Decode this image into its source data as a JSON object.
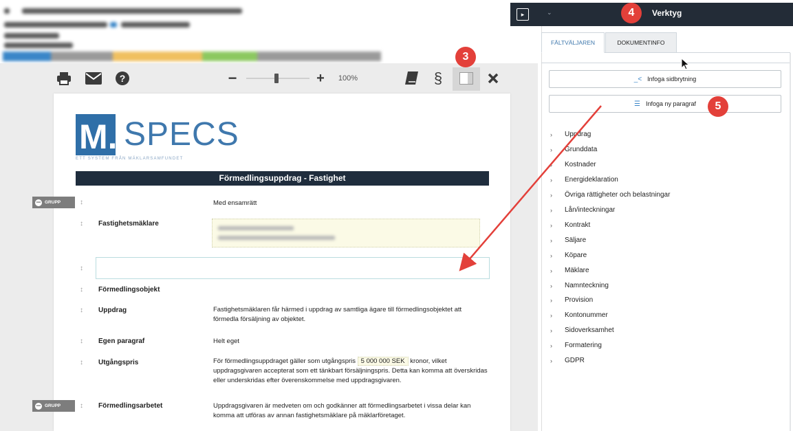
{
  "toolbar": {
    "print_icon": "printer-icon",
    "mail_icon": "envelope-icon",
    "help_icon": "question-icon",
    "zoom_minus": "−",
    "zoom_plus": "+",
    "zoom_value": "100%",
    "book_icon": "book-icon",
    "paragraph_symbol": "§",
    "layout_icon": "panel-toggle-icon",
    "close_icon": "close-icon"
  },
  "logo": {
    "m": "M.",
    "text": "SPECS",
    "tagline": "ETT SYSTEM FRÅN MÄKLARSAMFUNDET"
  },
  "document": {
    "title": "Förmedlingsuppdrag - Fastighet",
    "grupp_label": "GRUPP",
    "rows": [
      {
        "label": "",
        "text": "Med ensamrätt"
      },
      {
        "label": "Fastighetsmäklare",
        "text": ""
      },
      {
        "label": "",
        "text": ""
      },
      {
        "label": "Förmedlingsobjekt",
        "text": ""
      },
      {
        "label": "Uppdrag",
        "text": "Fastighetsmäklaren får härmed i uppdrag av samtliga ägare till förmedlingsobjektet att förmedla försäljning av objektet."
      },
      {
        "label": "Egen paragraf",
        "text": "Helt eget"
      },
      {
        "label": "Utgångspris",
        "text_before": "För förmedlingsuppdraget gäller som utgångspris",
        "highlight": "5 000 000 SEK",
        "text_after": "kronor, vilket uppdragsgivaren accepterat som ett tänkbart försäljningspris. Detta kan komma att överskridas eller underskridas efter överenskommelse med uppdragsgivaren."
      },
      {
        "label": "Förmedlingsarbetet",
        "text": "Uppdragsgivaren är medveten om och godkänner att förmedlingsarbetet i vissa delar kan komma att utföras av annan fastighetsmäklare på mäklarföretaget."
      }
    ]
  },
  "panel": {
    "title": "Verktyg",
    "tabs": [
      {
        "label": "FÄLTVÄLJAREN",
        "active": true
      },
      {
        "label": "DOKUMENTINFO",
        "active": false
      }
    ],
    "buttons": [
      {
        "label": "Infoga sidbrytning",
        "icon": "page-break-icon"
      },
      {
        "label": "Infoga ny paragraf",
        "icon": "list-icon"
      }
    ],
    "categories": [
      "Uppdrag",
      "Grunddata",
      "Kostnader",
      "Energideklaration",
      "Övriga rättigheter och belastningar",
      "Lån/inteckningar",
      "Kontrakt",
      "Säljare",
      "Köpare",
      "Mäklare",
      "Namnteckning",
      "Provision",
      "Kontonummer",
      "Sidoverksamhet",
      "Formatering",
      "GDPR"
    ]
  },
  "callouts": {
    "badge_3": "3",
    "badge_4": "4",
    "badge_5": "5",
    "color": "#e3403a"
  },
  "colors": {
    "title_bar": "#1f2d3d",
    "brand_blue": "#2f6fa8",
    "panel_header": "#232c37",
    "highlight_fill": "#fbfae6"
  }
}
